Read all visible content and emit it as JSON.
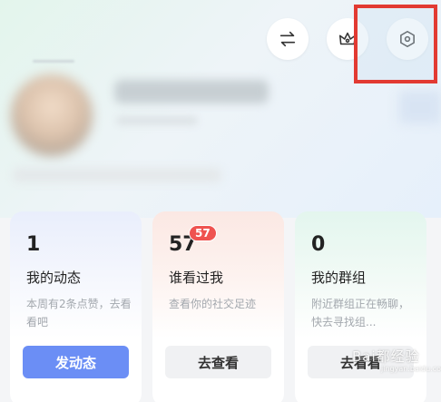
{
  "header": {
    "icons": [
      "swap-icon",
      "crown-icon",
      "settings-icon"
    ]
  },
  "cards": [
    {
      "count": "1",
      "title": "我的动态",
      "desc": "本周有2条点赞，去看看吧",
      "action": "发动态"
    },
    {
      "count": "57",
      "badge": "57",
      "title": "谁看过我",
      "desc": "查看你的社交足迹",
      "action": "去查看"
    },
    {
      "count": "0",
      "title": "我的群组",
      "desc": "附近群组正在畅聊，快去寻找组...",
      "action": "去看看"
    }
  ],
  "watermark": {
    "text": "Bai都经验",
    "sub": "jingyan.baidu.com"
  },
  "colors": {
    "primary": "#6b8ef5",
    "badge": "#ef5350",
    "highlight": "#e23a32"
  }
}
